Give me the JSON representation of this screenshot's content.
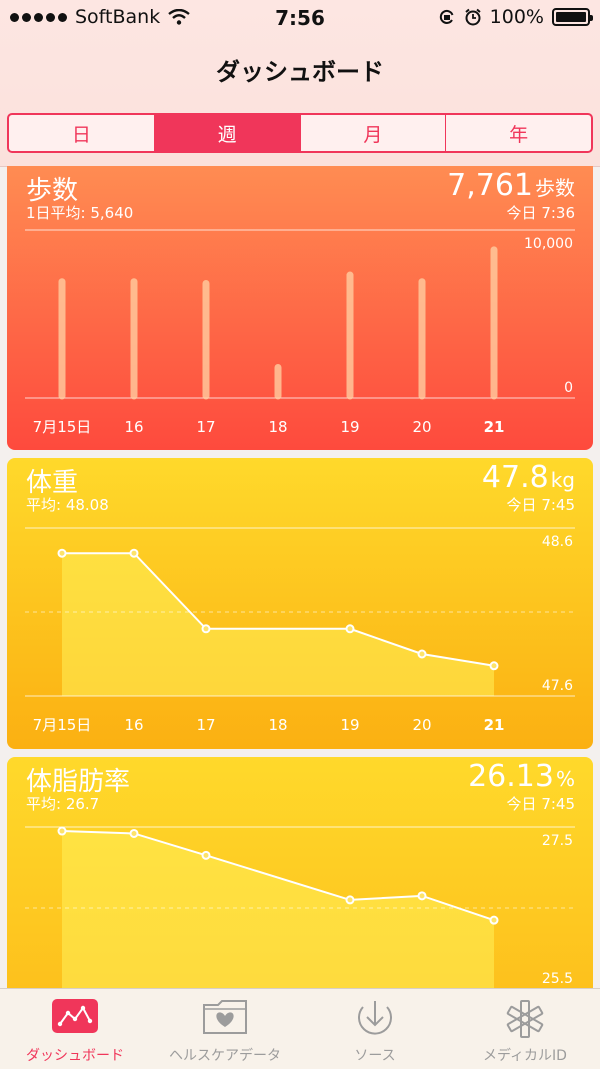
{
  "status_bar": {
    "carrier": "SoftBank",
    "time": "7:56",
    "battery": "100%"
  },
  "nav": {
    "title": "ダッシュボード"
  },
  "segments": [
    {
      "label": "日",
      "active": false
    },
    {
      "label": "週",
      "active": true
    },
    {
      "label": "月",
      "active": false
    },
    {
      "label": "年",
      "active": false
    }
  ],
  "cards": {
    "steps": {
      "title": "歩数",
      "subtitle": "1日平均: 5,640",
      "value": "7,761",
      "unit": "歩数",
      "updated": "今日 7:36",
      "y_max_label": "10,000",
      "y_min_label": "0"
    },
    "weight": {
      "title": "体重",
      "subtitle": "平均: 48.08",
      "value": "47.8",
      "unit": "kg",
      "updated": "今日 7:45",
      "y_max_label": "48.6",
      "y_min_label": "47.6"
    },
    "fat": {
      "title": "体脂肪率",
      "subtitle": "平均: 26.7",
      "value": "26.13",
      "unit": "%",
      "updated": "今日 7:45",
      "y_max_label": "27.5",
      "y_min_label": "25.5"
    }
  },
  "chart_data": [
    {
      "type": "bar",
      "title": "歩数",
      "categories": [
        "7月15日",
        "16",
        "17",
        "18",
        "19",
        "20",
        "21"
      ],
      "values": [
        6800,
        6800,
        6700,
        1700,
        7200,
        6800,
        8700
      ],
      "ylim": [
        0,
        10000
      ]
    },
    {
      "type": "line",
      "title": "体重",
      "categories": [
        "7月15日",
        "16",
        "17",
        "18",
        "19",
        "20",
        "21"
      ],
      "values": [
        48.45,
        48.45,
        48.0,
        null,
        48.0,
        47.85,
        47.78
      ],
      "ylim": [
        47.6,
        48.6
      ]
    },
    {
      "type": "line",
      "title": "体脂肪率",
      "categories": [
        "7月15日",
        "16",
        "17",
        "18",
        "19",
        "20",
        "21"
      ],
      "values": [
        27.45,
        27.42,
        27.15,
        null,
        26.6,
        26.65,
        26.35
      ],
      "ylim": [
        25.5,
        27.5
      ]
    }
  ],
  "tabs": [
    {
      "label": "ダッシュボード",
      "icon": "dashboard-icon",
      "active": true
    },
    {
      "label": "ヘルスケアデータ",
      "icon": "health-data-icon",
      "active": false
    },
    {
      "label": "ソース",
      "icon": "sources-icon",
      "active": false
    },
    {
      "label": "メディカルID",
      "icon": "medical-id-icon",
      "active": false
    }
  ],
  "colors": {
    "accent": "#f0365a",
    "steps": "#fe5a40",
    "weight": "#fcc51a",
    "fat": "#fdc81e"
  }
}
